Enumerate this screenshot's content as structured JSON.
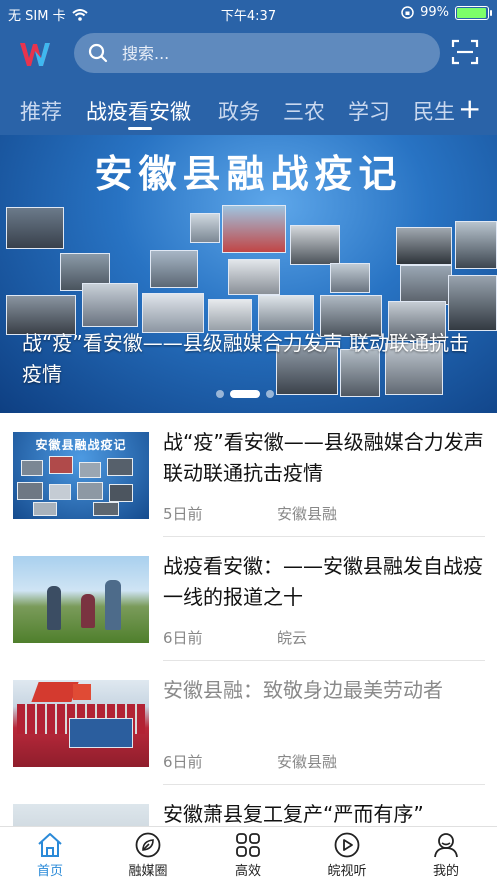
{
  "status_bar": {
    "carrier": "无 SIM 卡",
    "time": "下午4:37",
    "battery": "99%"
  },
  "search": {
    "placeholder": "搜索..."
  },
  "tabs": [
    {
      "label": "推荐"
    },
    {
      "label": "战疫看安徽"
    },
    {
      "label": "政务"
    },
    {
      "label": "三农"
    },
    {
      "label": "学习"
    },
    {
      "label": "民生"
    }
  ],
  "banner": {
    "title": "安徽县融战疫记",
    "caption": "战“疫”看安徽——县级融媒合力发声 联动联通抗击疫情",
    "slide_count": 3,
    "active_slide": 2
  },
  "news": [
    {
      "title": "战“疫”看安徽——县级融媒合力发声 联动联通抗击疫情",
      "time": "5日前",
      "source": "安徽县融",
      "read": false
    },
    {
      "title": "战疫看安徽：——安徽县融发自战疫一线的报道之十",
      "time": "6日前",
      "source": "皖云",
      "read": false
    },
    {
      "title": "安徽县融：致敬身边最美劳动者",
      "time": "6日前",
      "source": "安徽县融",
      "read": true
    },
    {
      "title": "安徽萧县复工复产“严而有序”",
      "time": "",
      "source": "",
      "read": false
    }
  ],
  "tabbar": [
    {
      "label": "首页",
      "icon": "home-icon",
      "active": true
    },
    {
      "label": "融媒圈",
      "icon": "leaf-icon",
      "active": false
    },
    {
      "label": "高效",
      "icon": "grid-icon",
      "active": false
    },
    {
      "label": "皖视听",
      "icon": "play-icon",
      "active": false
    },
    {
      "label": "我的",
      "icon": "user-icon",
      "active": false
    }
  ],
  "colors": {
    "header": "#2a63a8",
    "accent": "#2a8ad8"
  }
}
